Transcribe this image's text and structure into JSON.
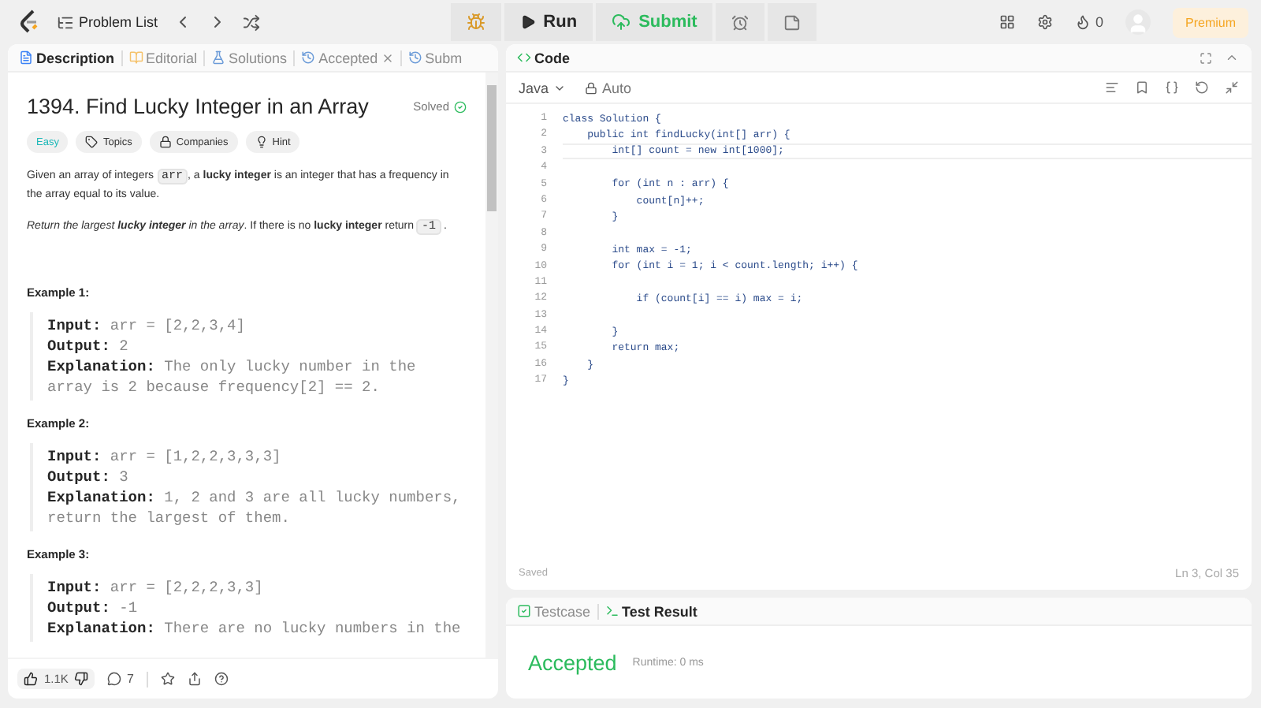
{
  "topbar": {
    "problem_list": "Problem List",
    "run": "Run",
    "submit": "Submit",
    "streak": "0",
    "premium": "Premium"
  },
  "left_tabs": [
    {
      "label": "Description",
      "kind": "description",
      "selected": true,
      "closable": false
    },
    {
      "label": "Editorial",
      "kind": "editorial",
      "selected": false,
      "closable": false
    },
    {
      "label": "Solutions",
      "kind": "solutions",
      "selected": false,
      "closable": false
    },
    {
      "label": "Accepted",
      "kind": "history",
      "selected": false,
      "closable": true
    },
    {
      "label": "Subm",
      "kind": "history",
      "selected": false,
      "closable": false
    }
  ],
  "problem": {
    "title": "1394. Find Lucky Integer in an Array",
    "status": "Solved",
    "tags": [
      {
        "label": "Easy",
        "kind": "difficulty"
      },
      {
        "label": "Topics",
        "kind": "tag"
      },
      {
        "label": "Companies",
        "kind": "lock"
      },
      {
        "label": "Hint",
        "kind": "bulb"
      }
    ],
    "paragraphs": [
      [
        {
          "kind": "plain",
          "text": "Given an array of integers "
        },
        {
          "kind": "code",
          "text": "arr"
        },
        {
          "kind": "plain",
          "text": ", a "
        },
        {
          "kind": "bold",
          "text": "lucky integer"
        },
        {
          "kind": "plain",
          "text": " is an integer that has a frequency in the array equal to its value."
        }
      ],
      [
        {
          "kind": "italic",
          "text": "Return the largest "
        },
        {
          "kind": "bolditalic",
          "text": "lucky integer"
        },
        {
          "kind": "italic",
          "text": " in the array"
        },
        {
          "kind": "plain",
          "text": ". If there is no "
        },
        {
          "kind": "bold",
          "text": "lucky integer"
        },
        {
          "kind": "plain",
          "text": " return "
        },
        {
          "kind": "code",
          "text": "-1"
        },
        {
          "kind": "plain",
          "text": " ."
        }
      ]
    ],
    "examples": [
      {
        "title": "Example 1:",
        "lines": [
          {
            "label": "Input:",
            "value": "arr = [2,2,3,4]"
          },
          {
            "label": "Output:",
            "value": "2"
          },
          {
            "label": "Explanation:",
            "value": "The only lucky number in the array is 2 because frequency[2] == 2."
          }
        ]
      },
      {
        "title": "Example 2:",
        "lines": [
          {
            "label": "Input:",
            "value": "arr = [1,2,2,3,3,3]"
          },
          {
            "label": "Output:",
            "value": "3"
          },
          {
            "label": "Explanation:",
            "value": "1, 2 and 3 are all lucky numbers, return the largest of them."
          }
        ]
      },
      {
        "title": "Example 3:",
        "lines": [
          {
            "label": "Input:",
            "value": "arr = [2,2,2,3,3]"
          },
          {
            "label": "Output:",
            "value": "-1"
          },
          {
            "label": "Explanation:",
            "value": "There are no lucky numbers in the"
          }
        ]
      }
    ]
  },
  "footer": {
    "likes": "1.1K",
    "comments": "7"
  },
  "code_panel": {
    "title": "Code",
    "language": "Java",
    "mode": "Auto",
    "lines": [
      {
        "number": "1",
        "text": "class Solution {",
        "current": false
      },
      {
        "number": "2",
        "text": "    public int findLucky(int[] arr) {",
        "current": false
      },
      {
        "number": "3",
        "text": "        int[] count = new int[1000];",
        "current": true
      },
      {
        "number": "4",
        "current": false
      },
      {
        "number": "5",
        "text": "        for (int n : arr) {",
        "current": false
      },
      {
        "number": "6",
        "text": "            count[n]++;",
        "current": false
      },
      {
        "number": "7",
        "text": "        }",
        "current": false
      },
      {
        "number": "8",
        "current": false
      },
      {
        "number": "9",
        "text": "        int max = -1;",
        "current": false
      },
      {
        "number": "10",
        "text": "        for (int i = 1; i < count.length; i++) {",
        "current": false
      },
      {
        "number": "11",
        "current": false
      },
      {
        "number": "12",
        "text": "            if (count[i] == i) max = i;",
        "current": false
      },
      {
        "number": "13",
        "current": false
      },
      {
        "number": "14",
        "text": "        }",
        "current": false
      },
      {
        "number": "15",
        "text": "        return max;",
        "current": false
      },
      {
        "number": "16",
        "text": "    }",
        "current": false
      },
      {
        "number": "17",
        "text": "}",
        "current": false
      }
    ],
    "saved": "Saved",
    "cursor": "Ln 3, Col 35"
  },
  "result_panel": {
    "tabs": [
      {
        "label": "Testcase",
        "kind": "testcase",
        "selected": false
      },
      {
        "label": "Test Result",
        "kind": "terminal",
        "selected": true
      }
    ],
    "verdict": "Accepted",
    "runtime": "Runtime: 0 ms"
  }
}
